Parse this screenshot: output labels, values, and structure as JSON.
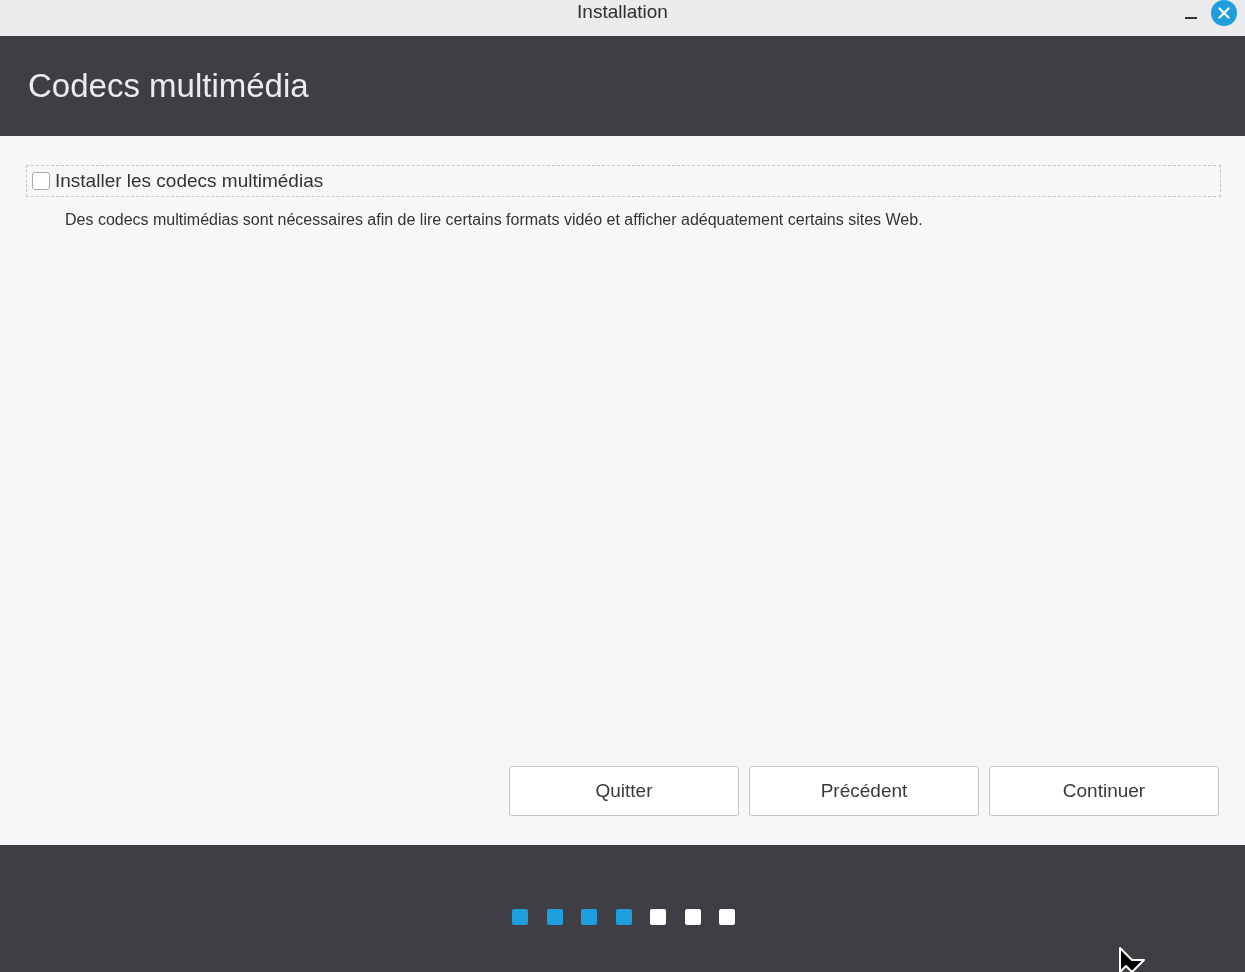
{
  "window": {
    "title": "Installation"
  },
  "header": {
    "title": "Codecs multimédia"
  },
  "option": {
    "label": "Installer les codecs multimédias",
    "checked": false,
    "description": "Des codecs multimédias sont nécessaires afin de lire certains formats vidéo et afficher adéquatement certains sites Web."
  },
  "buttons": [
    {
      "label": "Quitter"
    },
    {
      "label": "Précédent"
    },
    {
      "label": "Continuer"
    }
  ],
  "progress": {
    "steps": [
      {
        "done": true
      },
      {
        "done": true
      },
      {
        "done": true
      },
      {
        "done": true
      },
      {
        "done": false
      },
      {
        "done": false
      },
      {
        "done": false
      }
    ]
  }
}
